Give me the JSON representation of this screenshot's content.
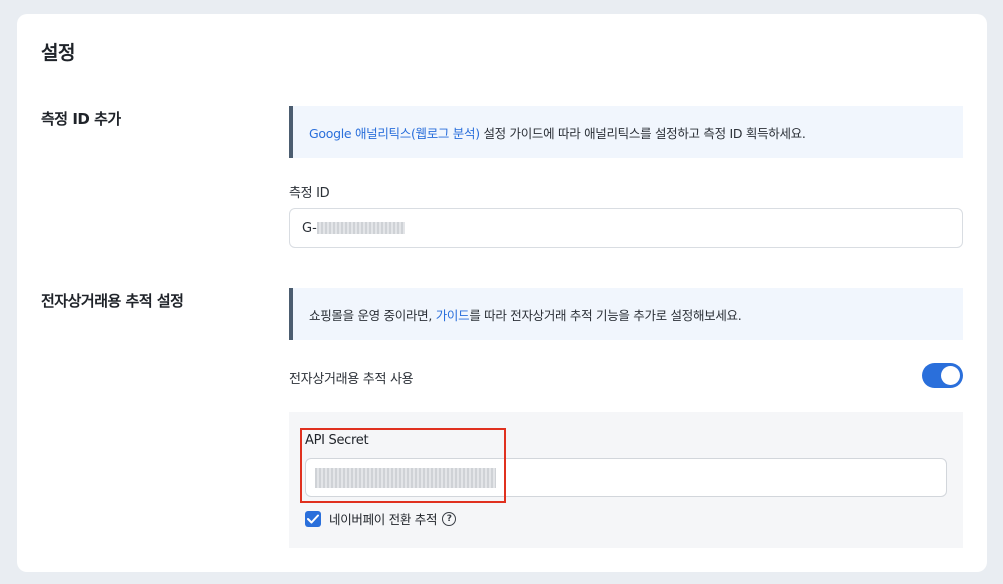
{
  "page": {
    "title": "설정"
  },
  "measurement": {
    "section_label": "측정 ID 추가",
    "notice_link": "Google 애널리틱스(웹로그 분석)",
    "notice_text": " 설정 가이드에 따라 애널리틱스를 설정하고 측정 ID 획득하세요.",
    "field_label": "측정 ID",
    "field_value_prefix": "G-"
  },
  "ecommerce": {
    "section_label": "전자상거래용 추적 설정",
    "notice_text_before": "쇼핑몰을 운영 중이라면, ",
    "notice_link": "가이드",
    "notice_text_after": "를 따라 전자상거래 추적 기능을 추가로 설정해보세요.",
    "toggle_label": "전자상거래용 추적 사용",
    "toggle_on": true,
    "api_secret_label": "API Secret",
    "checkbox_label": "네이버페이 전환 추적",
    "checkbox_checked": true
  },
  "colors": {
    "accent": "#2a6fdb",
    "highlight_border": "#e0311f",
    "notice_bg": "#f1f6fd"
  },
  "icons": {
    "toggle": "toggle-switch",
    "checkbox": "checkmark-icon",
    "help": "question-circle-icon"
  }
}
